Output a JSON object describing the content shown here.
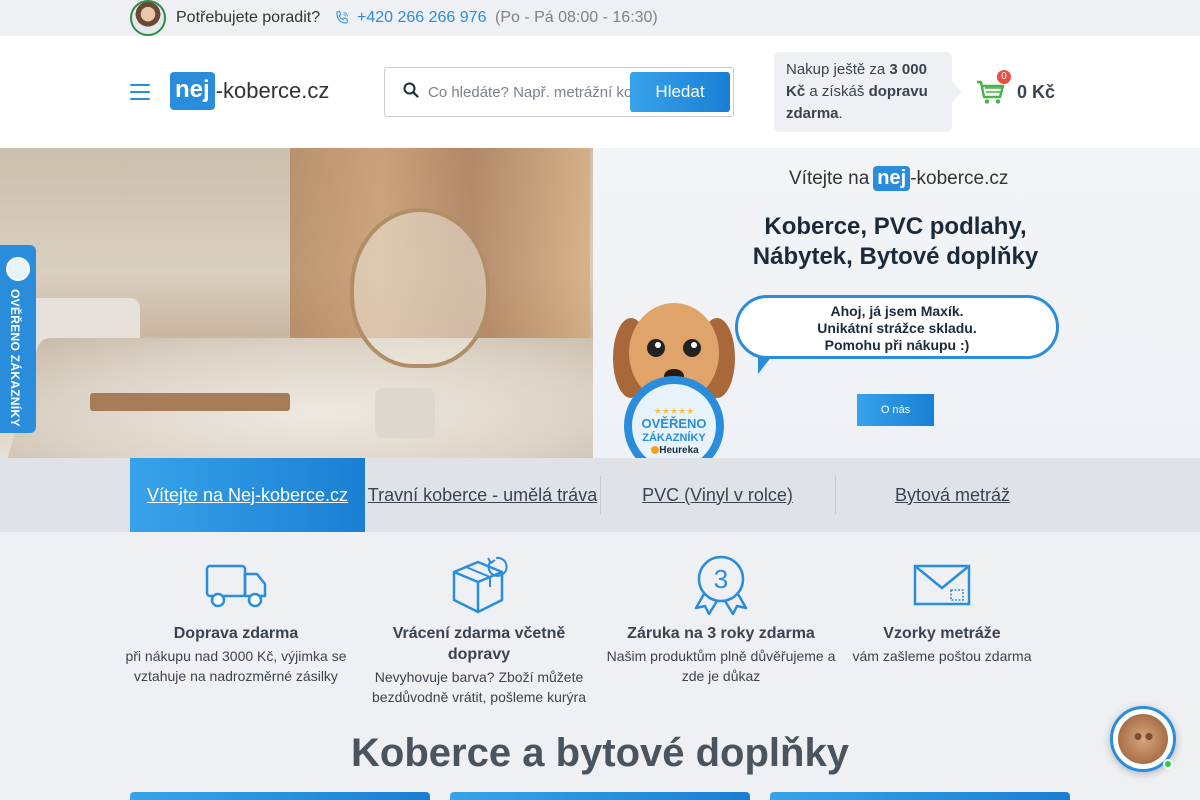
{
  "topbar": {
    "help": "Potřebujete poradit?",
    "phone": "+420 266 266 976",
    "hours": "(Po - Pá 08:00 - 16:30)"
  },
  "header": {
    "logo_badge": "nej",
    "logo_rest": "-koberce.cz",
    "search_placeholder": "Co hledáte? Např. metrážní koberec",
    "search_button": "Hledat",
    "shipping_prefix": "Nakup ještě za",
    "shipping_amount": "3 000 Kč",
    "shipping_mid": "a získáš",
    "shipping_bold": "dopravu zdarma",
    "shipping_end": ".",
    "cart_count": "0",
    "cart_total": "0 Kč"
  },
  "hero": {
    "welcome_prefix": "Vítejte na",
    "welcome_badge": "nej",
    "welcome_rest": "-koberce.cz",
    "headline_1": "Koberce, PVC podlahy,",
    "headline_2": "Nábytek, Bytové doplňky",
    "bubble_1": "Ahoj, já jsem Maxík.",
    "bubble_2": "Unikátní strážce skladu.",
    "bubble_3": "Pomohu při nákupu :)",
    "seal_1": "OVĚŘENO",
    "seal_2": "ZÁKAZNÍKY",
    "seal_brand": "Heureka",
    "about_button": "O nás"
  },
  "side_badge": {
    "text": "OVĚŘENO ZÁKAZNÍKY"
  },
  "tabs": [
    {
      "label": "Vítejte na Nej-koberce.cz"
    },
    {
      "label": "Travní koberce - umělá tráva"
    },
    {
      "label": "PVC (Vinyl v rolce)"
    },
    {
      "label": "Bytová metráž"
    }
  ],
  "features": [
    {
      "title": "Doprava zdarma",
      "desc": "při nákupu nad 3000 Kč, výjimka se vztahuje na nadrozměrné zásilky",
      "icon": "truck-icon"
    },
    {
      "title": "Vrácení zdarma včetně dopravy",
      "desc": "Nevyhovuje barva? Zboží můžete bezdůvodně vrátit, pošleme kurýra",
      "icon": "box-return-icon"
    },
    {
      "title": "Záruka na 3 roky zdarma",
      "desc": "Našim produktům plně důvěřujeme a zde je důkaz",
      "icon": "warranty-badge-icon"
    },
    {
      "title": "Vzorky metráže",
      "desc": "vám zašleme poštou zdarma",
      "icon": "envelope-icon"
    }
  ],
  "warranty_number": "3",
  "section_title": "Koberce a bytové doplňky",
  "colors": {
    "brand_blue": "#2a8ddc",
    "brand_gradient_start": "#37a3ea",
    "brand_gradient_end": "#1a7fd4",
    "cart_badge": "#ef4b45",
    "cart_green": "#47b34a",
    "online_dot": "#2ecc40"
  }
}
